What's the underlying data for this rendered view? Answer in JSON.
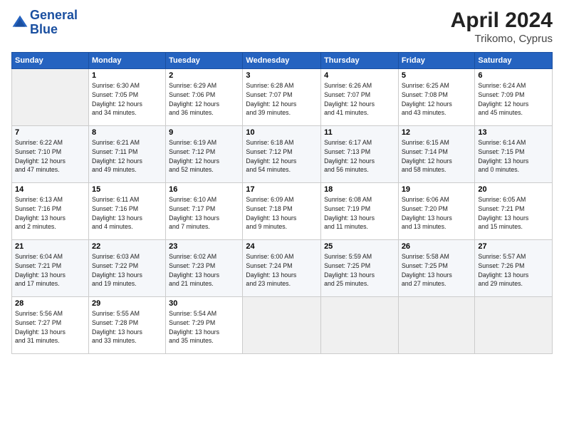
{
  "header": {
    "logo_line1": "General",
    "logo_line2": "Blue",
    "month": "April 2024",
    "location": "Trikomo, Cyprus"
  },
  "days_of_week": [
    "Sunday",
    "Monday",
    "Tuesday",
    "Wednesday",
    "Thursday",
    "Friday",
    "Saturday"
  ],
  "weeks": [
    [
      {
        "day": "",
        "info": ""
      },
      {
        "day": "1",
        "info": "Sunrise: 6:30 AM\nSunset: 7:05 PM\nDaylight: 12 hours\nand 34 minutes."
      },
      {
        "day": "2",
        "info": "Sunrise: 6:29 AM\nSunset: 7:06 PM\nDaylight: 12 hours\nand 36 minutes."
      },
      {
        "day": "3",
        "info": "Sunrise: 6:28 AM\nSunset: 7:07 PM\nDaylight: 12 hours\nand 39 minutes."
      },
      {
        "day": "4",
        "info": "Sunrise: 6:26 AM\nSunset: 7:07 PM\nDaylight: 12 hours\nand 41 minutes."
      },
      {
        "day": "5",
        "info": "Sunrise: 6:25 AM\nSunset: 7:08 PM\nDaylight: 12 hours\nand 43 minutes."
      },
      {
        "day": "6",
        "info": "Sunrise: 6:24 AM\nSunset: 7:09 PM\nDaylight: 12 hours\nand 45 minutes."
      }
    ],
    [
      {
        "day": "7",
        "info": "Sunrise: 6:22 AM\nSunset: 7:10 PM\nDaylight: 12 hours\nand 47 minutes."
      },
      {
        "day": "8",
        "info": "Sunrise: 6:21 AM\nSunset: 7:11 PM\nDaylight: 12 hours\nand 49 minutes."
      },
      {
        "day": "9",
        "info": "Sunrise: 6:19 AM\nSunset: 7:12 PM\nDaylight: 12 hours\nand 52 minutes."
      },
      {
        "day": "10",
        "info": "Sunrise: 6:18 AM\nSunset: 7:12 PM\nDaylight: 12 hours\nand 54 minutes."
      },
      {
        "day": "11",
        "info": "Sunrise: 6:17 AM\nSunset: 7:13 PM\nDaylight: 12 hours\nand 56 minutes."
      },
      {
        "day": "12",
        "info": "Sunrise: 6:15 AM\nSunset: 7:14 PM\nDaylight: 12 hours\nand 58 minutes."
      },
      {
        "day": "13",
        "info": "Sunrise: 6:14 AM\nSunset: 7:15 PM\nDaylight: 13 hours\nand 0 minutes."
      }
    ],
    [
      {
        "day": "14",
        "info": "Sunrise: 6:13 AM\nSunset: 7:16 PM\nDaylight: 13 hours\nand 2 minutes."
      },
      {
        "day": "15",
        "info": "Sunrise: 6:11 AM\nSunset: 7:16 PM\nDaylight: 13 hours\nand 4 minutes."
      },
      {
        "day": "16",
        "info": "Sunrise: 6:10 AM\nSunset: 7:17 PM\nDaylight: 13 hours\nand 7 minutes."
      },
      {
        "day": "17",
        "info": "Sunrise: 6:09 AM\nSunset: 7:18 PM\nDaylight: 13 hours\nand 9 minutes."
      },
      {
        "day": "18",
        "info": "Sunrise: 6:08 AM\nSunset: 7:19 PM\nDaylight: 13 hours\nand 11 minutes."
      },
      {
        "day": "19",
        "info": "Sunrise: 6:06 AM\nSunset: 7:20 PM\nDaylight: 13 hours\nand 13 minutes."
      },
      {
        "day": "20",
        "info": "Sunrise: 6:05 AM\nSunset: 7:21 PM\nDaylight: 13 hours\nand 15 minutes."
      }
    ],
    [
      {
        "day": "21",
        "info": "Sunrise: 6:04 AM\nSunset: 7:21 PM\nDaylight: 13 hours\nand 17 minutes."
      },
      {
        "day": "22",
        "info": "Sunrise: 6:03 AM\nSunset: 7:22 PM\nDaylight: 13 hours\nand 19 minutes."
      },
      {
        "day": "23",
        "info": "Sunrise: 6:02 AM\nSunset: 7:23 PM\nDaylight: 13 hours\nand 21 minutes."
      },
      {
        "day": "24",
        "info": "Sunrise: 6:00 AM\nSunset: 7:24 PM\nDaylight: 13 hours\nand 23 minutes."
      },
      {
        "day": "25",
        "info": "Sunrise: 5:59 AM\nSunset: 7:25 PM\nDaylight: 13 hours\nand 25 minutes."
      },
      {
        "day": "26",
        "info": "Sunrise: 5:58 AM\nSunset: 7:25 PM\nDaylight: 13 hours\nand 27 minutes."
      },
      {
        "day": "27",
        "info": "Sunrise: 5:57 AM\nSunset: 7:26 PM\nDaylight: 13 hours\nand 29 minutes."
      }
    ],
    [
      {
        "day": "28",
        "info": "Sunrise: 5:56 AM\nSunset: 7:27 PM\nDaylight: 13 hours\nand 31 minutes."
      },
      {
        "day": "29",
        "info": "Sunrise: 5:55 AM\nSunset: 7:28 PM\nDaylight: 13 hours\nand 33 minutes."
      },
      {
        "day": "30",
        "info": "Sunrise: 5:54 AM\nSunset: 7:29 PM\nDaylight: 13 hours\nand 35 minutes."
      },
      {
        "day": "",
        "info": ""
      },
      {
        "day": "",
        "info": ""
      },
      {
        "day": "",
        "info": ""
      },
      {
        "day": "",
        "info": ""
      }
    ]
  ]
}
